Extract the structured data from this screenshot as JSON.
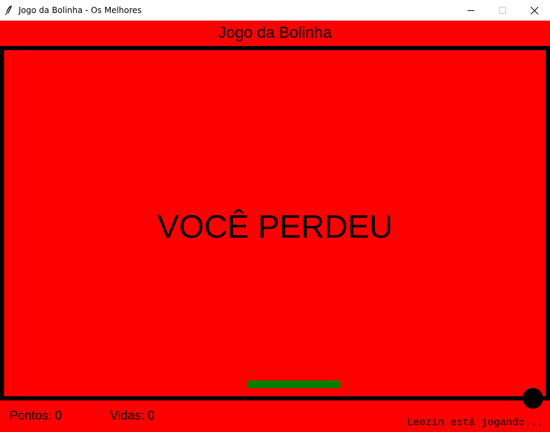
{
  "window": {
    "title": "Jogo da Bolinha - Os Melhores",
    "icon": "feather-icon",
    "controls": [
      "minimize-icon",
      "maximize-icon",
      "close-icon"
    ]
  },
  "header": {
    "title": "Jogo da Bolinha"
  },
  "game": {
    "message": "VOCÊ PERDEU",
    "background_color": "#ff0000",
    "paddle_color": "#008000",
    "ball_color": "#000000"
  },
  "status": {
    "score_text": "Pontos: 0",
    "lives_text": "Vidas: 0",
    "player_text": "Leozin está jogando..."
  }
}
